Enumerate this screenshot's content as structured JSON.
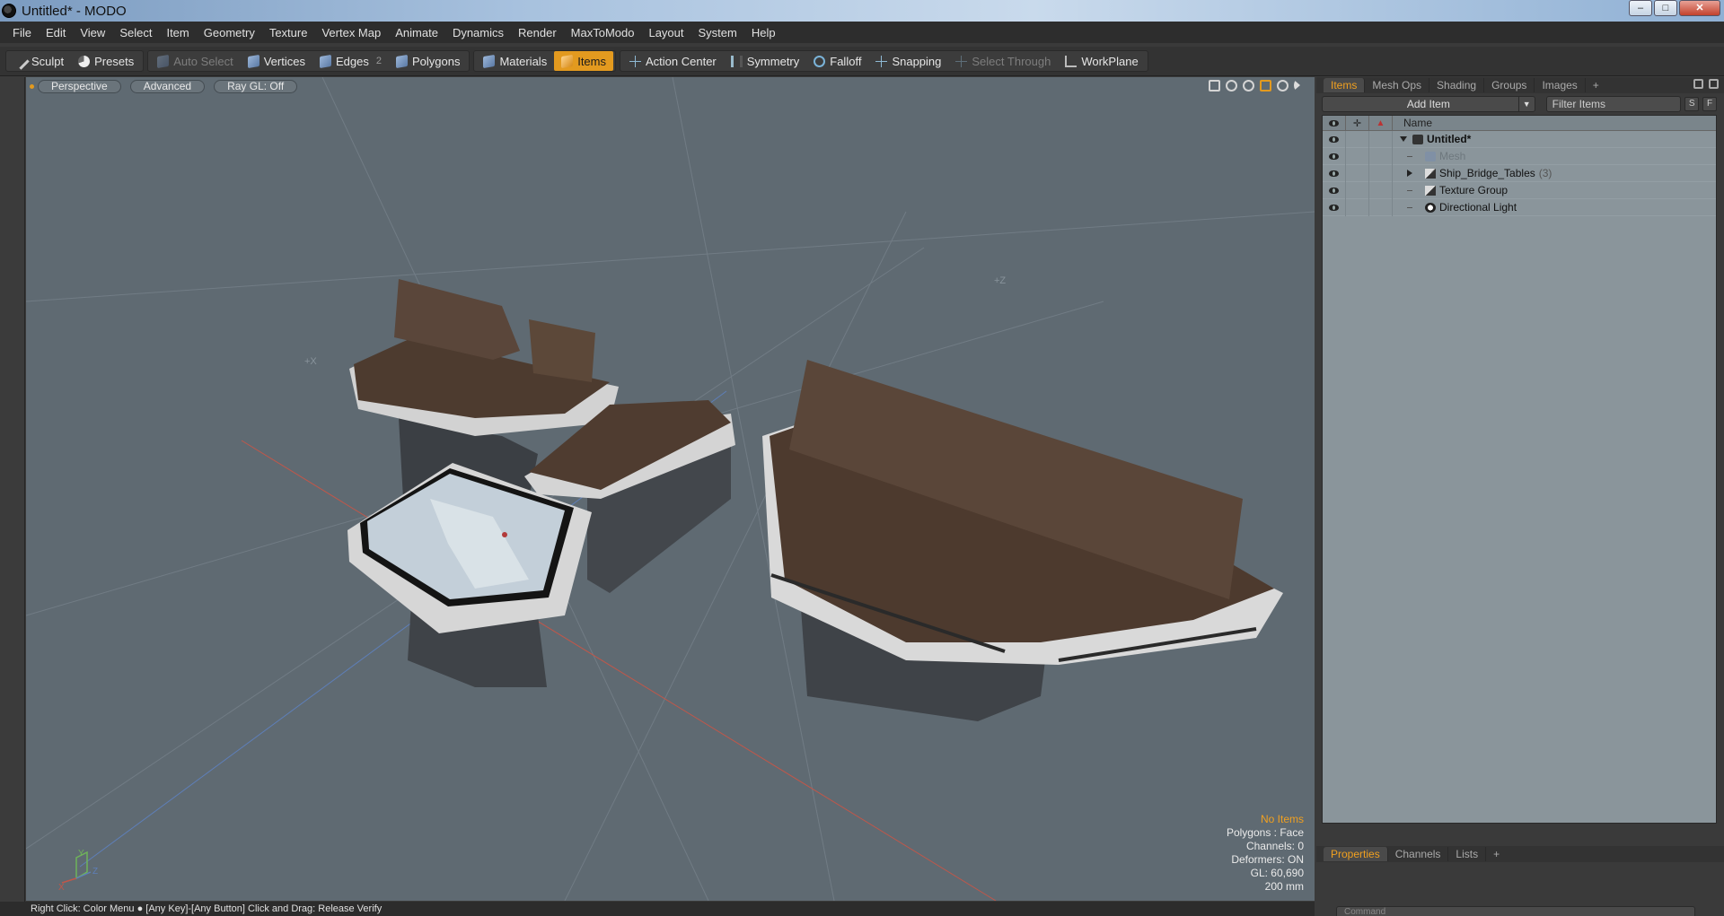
{
  "window": {
    "title": "Untitled* - MODO"
  },
  "menu": [
    "File",
    "Edit",
    "View",
    "Select",
    "Item",
    "Geometry",
    "Texture",
    "Vertex Map",
    "Animate",
    "Dynamics",
    "Render",
    "MaxToModo",
    "Layout",
    "System",
    "Help"
  ],
  "toolbar": {
    "sculpt": "Sculpt",
    "presets": "Presets",
    "auto_select": "Auto Select",
    "vertices": "Vertices",
    "edges": "Edges",
    "edges_count": "2",
    "polygons": "Polygons",
    "materials": "Materials",
    "items": "Items",
    "action_center": "Action Center",
    "symmetry": "Symmetry",
    "falloff": "Falloff",
    "snapping": "Snapping",
    "select_through": "Select Through",
    "workplane": "WorkPlane"
  },
  "viewport": {
    "tabs": [
      "Perspective",
      "Advanced",
      "Ray GL: Off"
    ],
    "axis_labels": {
      "x": "+X",
      "z": "+Z"
    },
    "gizmo": {
      "x": "X",
      "y": "Y",
      "z": "Z"
    },
    "info": {
      "no_items": "No Items",
      "polygons": "Polygons : Face",
      "channels": "Channels: 0",
      "deformers": "Deformers: ON",
      "gl": "GL: 60,690",
      "scale": "200 mm"
    }
  },
  "statusbar": {
    "text": "Right Click: Color Menu ● [Any Key]-[Any Button] Click and Drag: Release Verify"
  },
  "right_panel": {
    "tabs": [
      "Items",
      "Mesh Ops",
      "Shading",
      "Groups",
      "Images",
      "+"
    ],
    "add_item": "Add Item",
    "filter_placeholder": "Filter Items",
    "s_btn": "S",
    "f_btn": "F",
    "name_header": "Name",
    "tree": [
      {
        "label": "Untitled*",
        "icon": "scene-icon",
        "expand": "open",
        "bold": true
      },
      {
        "label": "Mesh",
        "icon": "mesh-icon",
        "expand": "none",
        "dim": true
      },
      {
        "label": "Ship_Bridge_Tables",
        "count": "(3)",
        "icon": "group-icon",
        "expand": "closed"
      },
      {
        "label": "Texture Group",
        "icon": "texture-group-icon",
        "expand": "none"
      },
      {
        "label": "Directional Light",
        "icon": "light-icon",
        "expand": "none"
      }
    ],
    "props_tabs": [
      "Properties",
      "Channels",
      "Lists",
      "+"
    ],
    "command_placeholder": "Command"
  },
  "colors": {
    "accent": "#e39a1f",
    "viewport_bg": "#5f6a72",
    "table_top": "#4e3c30",
    "table_body": "#d8d8d8"
  }
}
